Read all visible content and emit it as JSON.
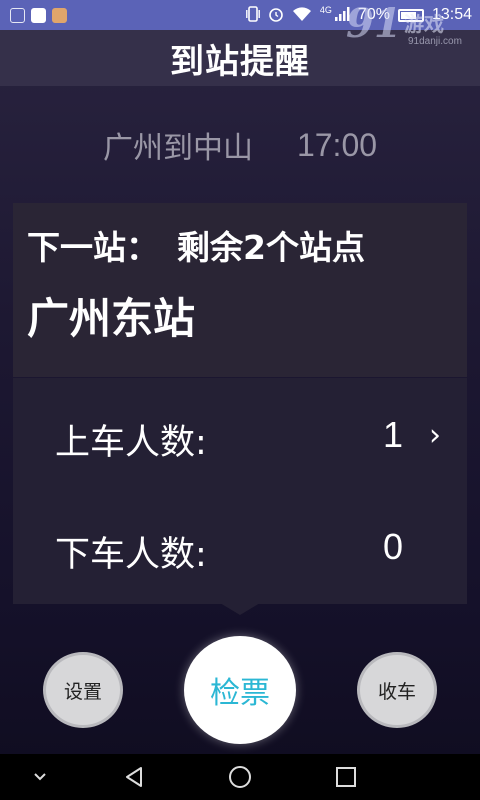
{
  "status_bar": {
    "battery": "70%",
    "time": "13:54",
    "network": "4G",
    "notification_icons": [
      "gallery-icon",
      "wechat-icon",
      "app-icon"
    ],
    "status_icons": [
      "vibrate-icon",
      "alarm-icon",
      "wifi-icon",
      "signal-icon",
      "battery-icon"
    ]
  },
  "watermark": {
    "logo": "91",
    "text": "游戏",
    "url": "91danji.com"
  },
  "header": {
    "title": "到站提醒"
  },
  "route": {
    "name": "广州到中山",
    "time": "17:00"
  },
  "next_stop": {
    "label": "下一站：",
    "remaining": "剩余2个站点",
    "station": "广州东站"
  },
  "counts": {
    "boarding_label": "上车人数:",
    "boarding_value": "1",
    "alighting_label": "下车人数:",
    "alighting_value": "0"
  },
  "actions": {
    "settings": "设置",
    "ticket_check": "检票",
    "close_shift": "收车"
  },
  "nav_bar": {
    "icons": [
      "hide-icon",
      "back-icon",
      "home-icon",
      "recent-apps-icon"
    ]
  },
  "colors": {
    "status_bar": "#5b63b7",
    "header": "#35304a",
    "card": "#2a2535",
    "ticket_text": "#2bb7d4"
  }
}
